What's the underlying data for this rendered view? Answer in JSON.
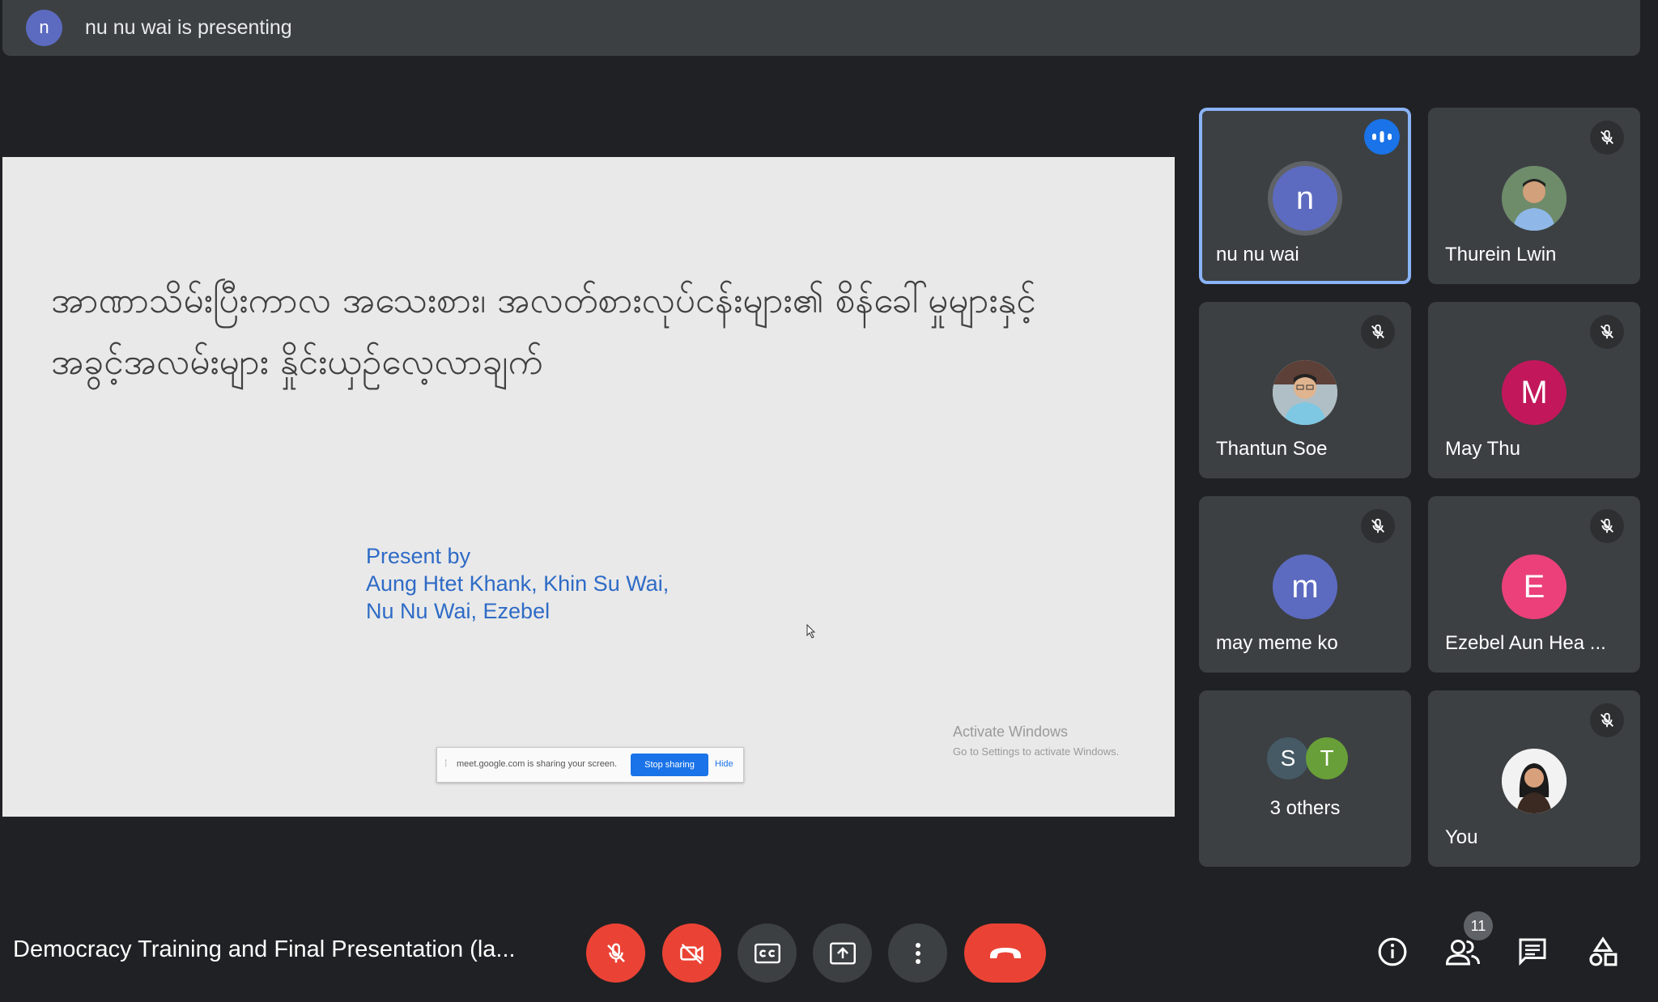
{
  "top_bar": {
    "avatar_initial": "n",
    "presenting_text": "nu nu wai is presenting"
  },
  "slide": {
    "title": "အာဏာသိမ်းပြီးကာလ အသေးစား၊ အလတ်စားလုပ်ငန်းများ၏ စိန်ခေါ်မှုများနှင့် အခွင့်အလမ်းများ နှိုင်းယှဉ်လေ့လာချက်",
    "credits": [
      "Present by",
      "Aung Htet Khank, Khin Su Wai,",
      "Nu Nu Wai, Ezebel"
    ],
    "share_notice": {
      "text": "meet.google.com is sharing your screen.",
      "stop_label": "Stop sharing",
      "hide_label": "Hide"
    },
    "watermark": {
      "title": "Activate Windows",
      "subtitle": "Go to Settings to activate Windows."
    }
  },
  "participants": [
    {
      "name": "nu nu wai",
      "initial": "n",
      "avatar_color": "#5c6bc0",
      "status": "speaking",
      "active": true
    },
    {
      "name": "Thurein Lwin",
      "avatar_type": "photo",
      "status": "muted"
    },
    {
      "name": "Thantun Soe",
      "avatar_type": "photo",
      "status": "muted"
    },
    {
      "name": "May Thu",
      "initial": "M",
      "avatar_color": "#c2185b",
      "status": "muted"
    },
    {
      "name": "may meme ko",
      "initial": "m",
      "avatar_color": "#5c6bc0",
      "status": "muted"
    },
    {
      "name": "Ezebel Aun Hea ...",
      "initial": "E",
      "avatar_color": "#ec407a",
      "status": "muted"
    },
    {
      "name": "You",
      "avatar_type": "photo",
      "status": "muted"
    }
  ],
  "others_tile": {
    "label": "3 others",
    "avatars": [
      {
        "initial": "S",
        "color": "#455a64"
      },
      {
        "initial": "T",
        "color": "#689f38"
      }
    ]
  },
  "bottom_bar": {
    "meeting_title": "Democracy Training and Final Presentation (la...",
    "controls": [
      "mic-off",
      "camera-off",
      "captions",
      "present-screen",
      "more-options",
      "end-call"
    ],
    "right_controls": [
      "meeting-details",
      "people",
      "chat",
      "activities"
    ],
    "people_count": "11"
  },
  "colors": {
    "background": "#202124",
    "tile": "#3c4043",
    "danger": "#ea4335",
    "accent": "#1a73e8",
    "active_border": "#8ab4f8"
  }
}
